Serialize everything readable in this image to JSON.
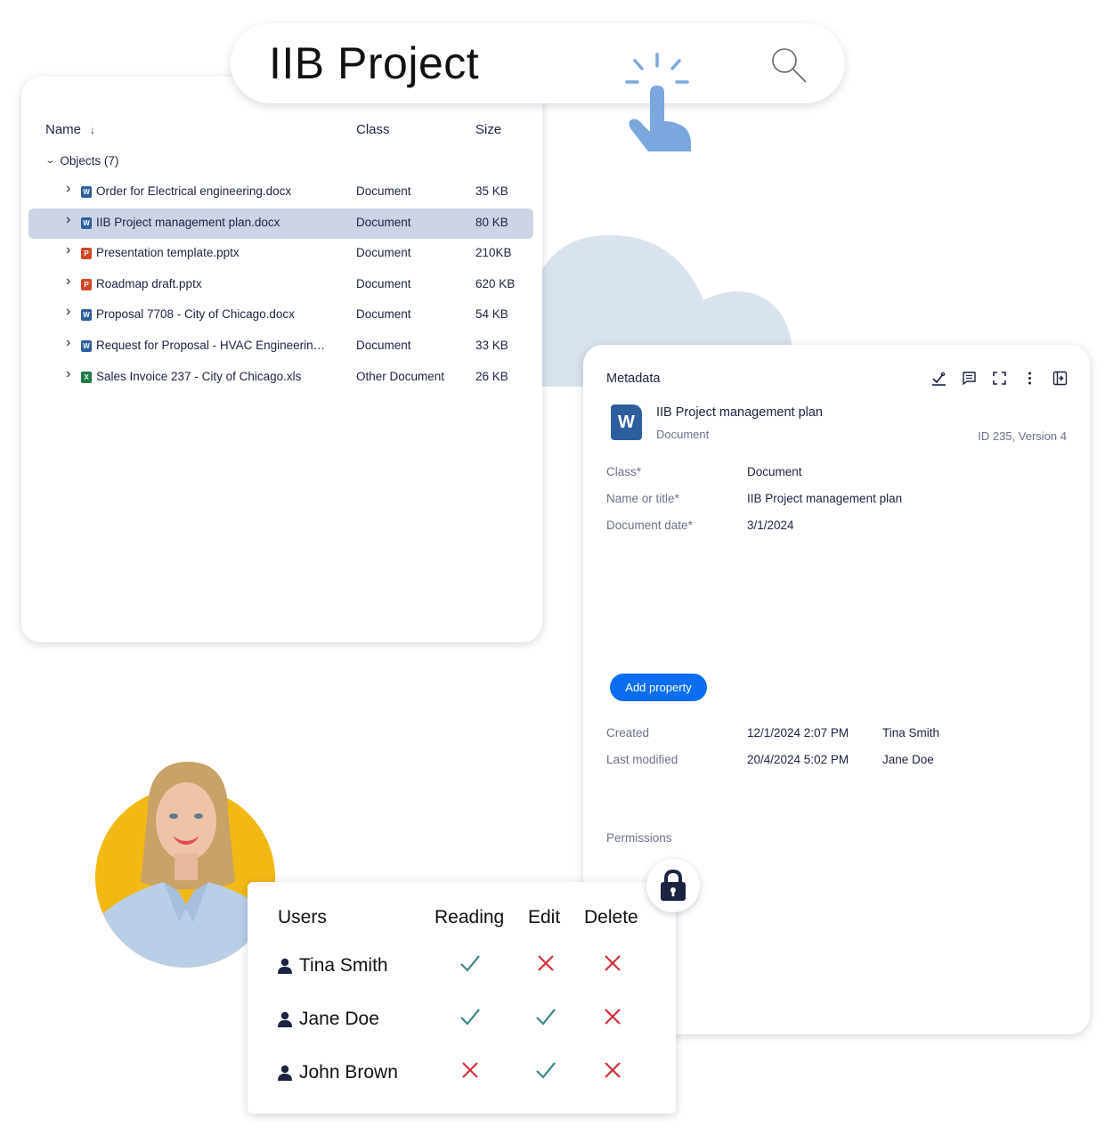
{
  "search": {
    "query": "IIB Project",
    "search_icon": "magnifier-icon",
    "pointer_icon": "tap-hand-icon"
  },
  "file_list": {
    "columns": {
      "name": "Name",
      "class": "Class",
      "size": "Size"
    },
    "sort_indicator": "↓",
    "group_label": "Objects (7)",
    "rows": [
      {
        "name": "Order for Electrical engineering.docx",
        "class": "Document",
        "size": "35 KB",
        "type": "word",
        "type_letter": "W",
        "selected": false
      },
      {
        "name": "IIB Project management plan.docx",
        "class": "Document",
        "size": "80 KB",
        "type": "word",
        "type_letter": "W",
        "selected": true
      },
      {
        "name": "Presentation template.pptx",
        "class": "Document",
        "size": "210KB",
        "type": "powerpoint",
        "type_letter": "P",
        "selected": false
      },
      {
        "name": "Roadmap draft.pptx",
        "class": "Document",
        "size": "620 KB",
        "type": "powerpoint",
        "type_letter": "P",
        "selected": false
      },
      {
        "name": "Proposal 7708 - City of Chicago.docx",
        "class": "Document",
        "size": "54 KB",
        "type": "word",
        "type_letter": "W",
        "selected": false
      },
      {
        "name": "Request for Proposal - HVAC Engineerin…",
        "class": "Document",
        "size": "33 KB",
        "type": "word",
        "type_letter": "W",
        "selected": false
      },
      {
        "name": "Sales Invoice 237 - City of Chicago.xls",
        "class": "Other Document",
        "size": "26 KB",
        "type": "excel",
        "type_letter": "X",
        "selected": false
      }
    ]
  },
  "metadata": {
    "title": "Metadata",
    "tools": [
      "workflow-icon",
      "comments-icon",
      "fullscreen-icon",
      "more-icon",
      "collapse-panel-icon"
    ],
    "document": {
      "icon_letter": "W",
      "name": "IIB Project management plan",
      "class": "Document",
      "id_version": "ID 235, Version 4"
    },
    "properties": [
      {
        "label": "Class*",
        "value": "Document"
      },
      {
        "label": "Name or title*",
        "value": "IIB Project management plan"
      },
      {
        "label": "Document date*",
        "value": "3/1/2024"
      }
    ],
    "add_property_label": "Add property",
    "history": [
      {
        "label": "Created",
        "value": "12/1/2024 2:07 PM",
        "user": "Tina Smith"
      },
      {
        "label": "Last modified",
        "value": "20/4/2024 5:02 PM",
        "user": "Jane Doe"
      }
    ],
    "permissions_label": "Permissions"
  },
  "permissions_table": {
    "headers": {
      "users": "Users",
      "reading": "Reading",
      "edit": "Edit",
      "delete": "Delete"
    },
    "rows": [
      {
        "user": "Tina Smith",
        "reading": true,
        "edit": false,
        "delete": false
      },
      {
        "user": "Jane Doe",
        "reading": true,
        "edit": true,
        "delete": false
      },
      {
        "user": "John Brown",
        "reading": false,
        "edit": true,
        "delete": false
      }
    ]
  },
  "colors": {
    "word": "#2c5e9e",
    "powerpoint": "#d24726",
    "excel": "#1e7b45",
    "selected_row": "#ccd4e6",
    "accent": "#0b6ef2",
    "check": "#3d8a86",
    "cross": "#d3303c",
    "cloud": "#d9e3ee",
    "avatar_bg": "#f2b915",
    "pointer": "#7aa7dd"
  }
}
